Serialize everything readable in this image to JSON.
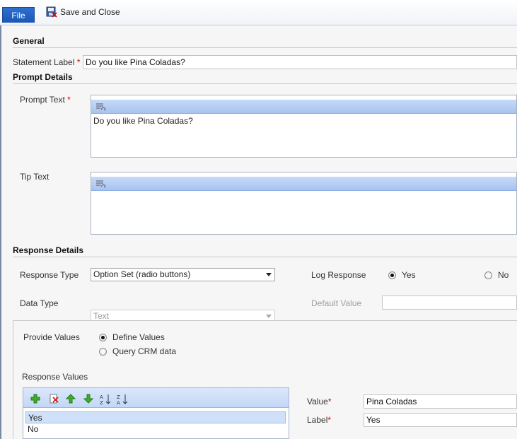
{
  "ribbon": {
    "file_label": "File",
    "save_close_label": "Save and Close"
  },
  "general": {
    "title": "General",
    "statement_label": "Statement Label",
    "statement_value": "Do you like Pina Coladas?"
  },
  "prompt": {
    "title": "Prompt Details",
    "prompt_text_label": "Prompt Text",
    "prompt_text_value": "Do you like Pina Coladas?",
    "tip_text_label": "Tip Text",
    "tip_text_value": ""
  },
  "response": {
    "title": "Response Details",
    "response_type_label": "Response Type",
    "response_type_value": "Option Set (radio buttons)",
    "log_response_label": "Log Response",
    "log_yes": "Yes",
    "log_no": "No",
    "log_selected": "Yes",
    "data_type_label": "Data Type",
    "data_type_value": "Text",
    "default_value_label": "Default Value",
    "default_value_value": ""
  },
  "values": {
    "provide_label": "Provide Values",
    "define_label": "Define Values",
    "query_label": "Query CRM data",
    "provide_selected": "Define Values",
    "response_values_label": "Response Values",
    "items": [
      "Yes",
      "No"
    ],
    "selected_item": "Yes",
    "value_label": "Value",
    "value_value": "Pina Coladas",
    "label_label": "Label",
    "label_value": "Yes"
  },
  "colors": {
    "required": "#d00000",
    "file_button": "#1a56b5",
    "rte_toolbar": "#b5cdf4"
  },
  "icons": {
    "save_close": "save-close-icon",
    "rte": "rich-text-editor-icon",
    "add": "add-icon",
    "delete": "delete-icon",
    "move_up": "arrow-up-icon",
    "move_down": "arrow-down-icon",
    "sort_az": "sort-ascending-icon",
    "sort_za": "sort-descending-icon"
  }
}
